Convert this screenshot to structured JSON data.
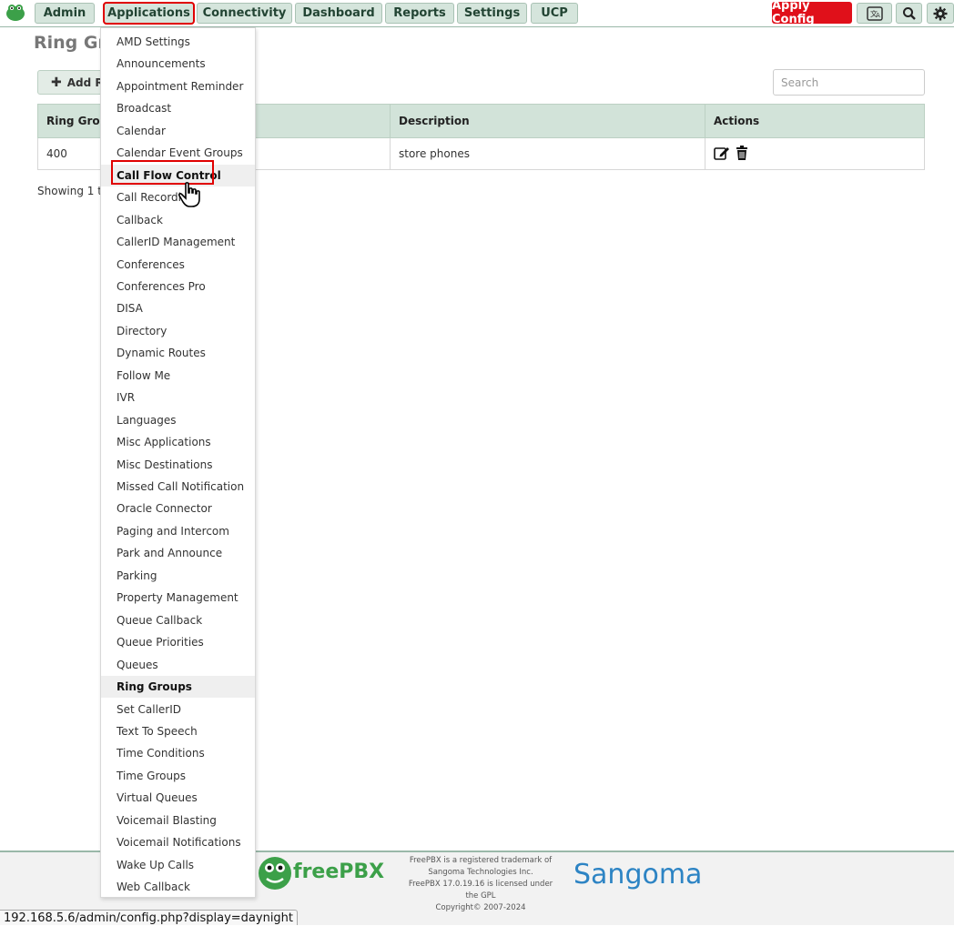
{
  "nav": {
    "items": [
      {
        "label": "Admin"
      },
      {
        "label": "Applications"
      },
      {
        "label": "Connectivity"
      },
      {
        "label": "Dashboard"
      },
      {
        "label": "Reports"
      },
      {
        "label": "Settings"
      },
      {
        "label": "UCP"
      }
    ],
    "apply_label": "Apply Config",
    "icons": [
      "translate-icon",
      "search-icon",
      "gear-icon"
    ]
  },
  "page": {
    "title": "Ring Gro",
    "add_label": "Add R",
    "search_placeholder": "Search",
    "table": {
      "headers": [
        "Ring Grou",
        "Description",
        "Actions"
      ],
      "rows": [
        {
          "number": "400",
          "description": "store phones"
        }
      ]
    },
    "showing": "Showing 1 t"
  },
  "menu": {
    "items": [
      "AMD Settings",
      "Announcements",
      "Appointment Reminder",
      "Broadcast",
      "Calendar",
      "Calendar Event Groups",
      "Call Flow Control",
      "Call Recordi",
      "Callback",
      "CallerID Management",
      "Conferences",
      "Conferences Pro",
      "DISA",
      "Directory",
      "Dynamic Routes",
      "Follow Me",
      "IVR",
      "Languages",
      "Misc Applications",
      "Misc Destinations",
      "Missed Call Notification",
      "Oracle Connector",
      "Paging and Intercom",
      "Park and Announce",
      "Parking",
      "Property Management",
      "Queue Callback",
      "Queue Priorities",
      "Queues",
      "Ring Groups",
      "Set CallerID",
      "Text To Speech",
      "Time Conditions",
      "Time Groups",
      "Virtual Queues",
      "Voicemail Blasting",
      "Voicemail Notifications",
      "Wake Up Calls",
      "Web Callback"
    ],
    "hovered": "Call Flow Control",
    "current": "Ring Groups"
  },
  "footer": {
    "freepbx": "freePBX",
    "legal": [
      "FreePBX is a registered trademark of",
      "Sangoma Technologies Inc.",
      "FreePBX 17.0.19.16 is licensed under",
      "the GPL",
      "Copyright© 2007-2024"
    ],
    "sangoma": "Sangoma"
  },
  "status_url": "192.168.5.6/admin/config.php?display=daynight",
  "colors": {
    "accent": "#d5e5dc",
    "apply": "#e0101a",
    "highlight": "#e00000"
  }
}
